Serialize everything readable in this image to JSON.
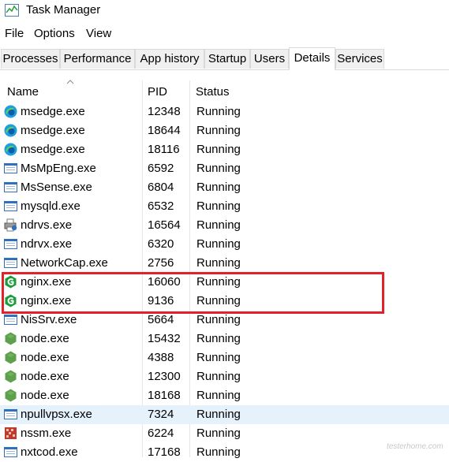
{
  "window": {
    "title": "Task Manager"
  },
  "menu": [
    "File",
    "Options",
    "View"
  ],
  "tabs": [
    "Processes",
    "Performance",
    "App history",
    "Startup",
    "Users",
    "Details",
    "Services"
  ],
  "active_tab": "Details",
  "columns": {
    "name": "Name",
    "pid": "PID",
    "status": "Status"
  },
  "rows": [
    {
      "name": "msedge.exe",
      "pid": "12348",
      "status": "Running",
      "icon": "edge-icon"
    },
    {
      "name": "msedge.exe",
      "pid": "18644",
      "status": "Running",
      "icon": "edge-icon"
    },
    {
      "name": "msedge.exe",
      "pid": "18116",
      "status": "Running",
      "icon": "edge-icon"
    },
    {
      "name": "MsMpEng.exe",
      "pid": "6592",
      "status": "Running",
      "icon": "window-icon"
    },
    {
      "name": "MsSense.exe",
      "pid": "6804",
      "status": "Running",
      "icon": "window-icon"
    },
    {
      "name": "mysqld.exe",
      "pid": "6532",
      "status": "Running",
      "icon": "window-icon"
    },
    {
      "name": "ndrvs.exe",
      "pid": "16564",
      "status": "Running",
      "icon": "printer-icon"
    },
    {
      "name": "ndrvx.exe",
      "pid": "6320",
      "status": "Running",
      "icon": "window-icon"
    },
    {
      "name": "NetworkCap.exe",
      "pid": "2756",
      "status": "Running",
      "icon": "window-icon"
    },
    {
      "name": "nginx.exe",
      "pid": "16060",
      "status": "Running",
      "icon": "nginx-icon"
    },
    {
      "name": "nginx.exe",
      "pid": "9136",
      "status": "Running",
      "icon": "nginx-icon"
    },
    {
      "name": "NisSrv.exe",
      "pid": "5664",
      "status": "Running",
      "icon": "window-icon"
    },
    {
      "name": "node.exe",
      "pid": "15432",
      "status": "Running",
      "icon": "node-icon"
    },
    {
      "name": "node.exe",
      "pid": "4388",
      "status": "Running",
      "icon": "node-icon"
    },
    {
      "name": "node.exe",
      "pid": "12300",
      "status": "Running",
      "icon": "node-icon"
    },
    {
      "name": "node.exe",
      "pid": "18168",
      "status": "Running",
      "icon": "node-icon"
    },
    {
      "name": "npullvpsx.exe",
      "pid": "7324",
      "status": "Running",
      "icon": "window-icon"
    },
    {
      "name": "nssm.exe",
      "pid": "6224",
      "status": "Running",
      "icon": "nssm-icon"
    },
    {
      "name": "nxtcod.exe",
      "pid": "17168",
      "status": "Running",
      "icon": "window-icon"
    }
  ],
  "selected_row": 16,
  "colors": {
    "highlight": "#e3212b",
    "selection": "#e5f1fb",
    "edge": "#1f9ede",
    "nginx": "#1a9c3a",
    "node": "#5fa04e"
  }
}
